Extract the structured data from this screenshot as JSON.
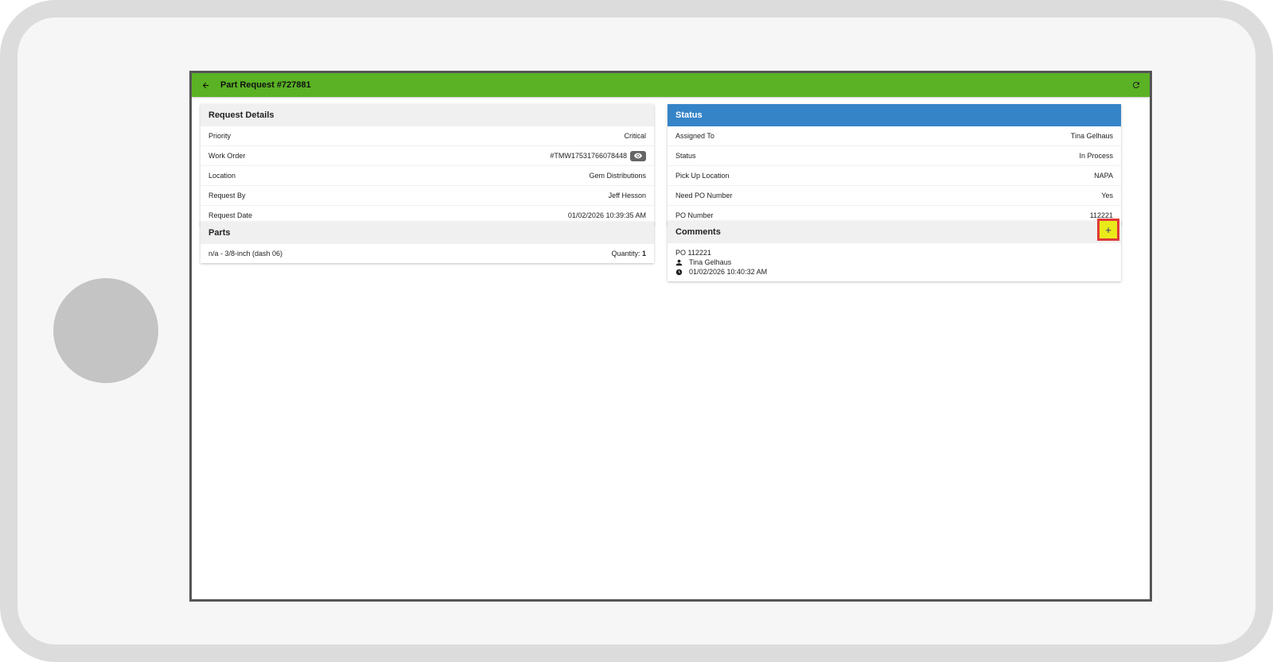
{
  "app": {
    "title": "Part Request #727881"
  },
  "request_details": {
    "header": "Request Details",
    "rows": [
      {
        "label": "Priority",
        "value": "Critical"
      },
      {
        "label": "Work Order",
        "value": "#TMW17531766078448"
      },
      {
        "label": "Location",
        "value": "Gem Distributions"
      },
      {
        "label": "Request By",
        "value": "Jeff Hesson"
      },
      {
        "label": "Request Date",
        "value": "01/02/2026 10:39:35 AM"
      }
    ]
  },
  "parts": {
    "header": "Parts",
    "items": [
      {
        "name": "n/a - 3/8-inch (dash 06)",
        "quantity_label": "Quantity:",
        "quantity": "1"
      }
    ]
  },
  "status": {
    "header": "Status",
    "rows": [
      {
        "label": "Assigned To",
        "value": "Tina Gelhaus"
      },
      {
        "label": "Status",
        "value": "In Process"
      },
      {
        "label": "Pick Up Location",
        "value": "NAPA"
      },
      {
        "label": "Need PO Number",
        "value": "Yes"
      },
      {
        "label": "PO Number",
        "value": "112221"
      }
    ]
  },
  "comments": {
    "header": "Comments",
    "add_label": "+",
    "items": [
      {
        "text": "PO 112221",
        "author": "Tina Gelhaus",
        "timestamp": "01/02/2026 10:40:32 AM"
      }
    ]
  },
  "colors": {
    "appbar": "#5ab224",
    "status_header": "#3584c8",
    "highlight": "#eaea1a",
    "highlight_border": "#e03a3a"
  },
  "icons": {
    "back": "arrow-left-icon",
    "refresh": "refresh-icon",
    "eye": "eye-icon",
    "user": "user-icon",
    "clock": "clock-icon"
  }
}
